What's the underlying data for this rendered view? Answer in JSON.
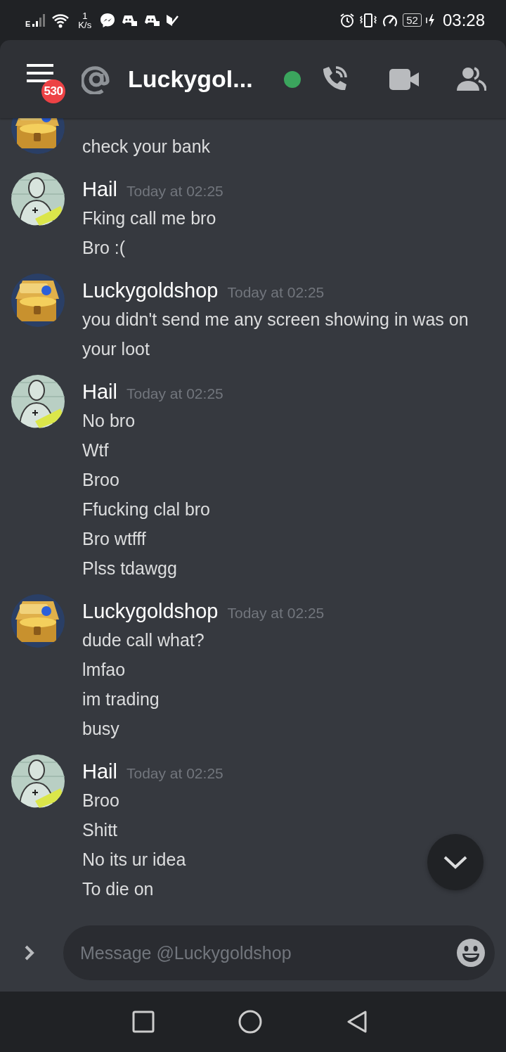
{
  "status_bar": {
    "network": "E",
    "speed_value": "1",
    "speed_unit": "K/s",
    "battery": "52",
    "time": "03:28"
  },
  "header": {
    "badge": "530",
    "title": "Luckygol...",
    "online": true
  },
  "messages": [
    {
      "kind": "continuation",
      "lines": [
        "check your bank"
      ]
    },
    {
      "kind": "group",
      "author": "Hail",
      "time": "Today at 02:25",
      "lines": [
        "Fking call me bro",
        "Bro :("
      ]
    },
    {
      "kind": "group",
      "author": "Luckygoldshop",
      "time": "Today at 02:25",
      "lines": [
        "you didn't send me any screen showing in was on your loot"
      ]
    },
    {
      "kind": "group",
      "author": "Hail",
      "time": "Today at 02:25",
      "lines": [
        "No bro",
        "Wtf",
        "Broo",
        "Ffucking clal bro",
        "Bro wtfff",
        "Plss tdawgg"
      ]
    },
    {
      "kind": "group",
      "author": "Luckygoldshop",
      "time": "Today at 02:25",
      "lines": [
        "dude call what?",
        "lmfao",
        "im trading",
        "busy"
      ]
    },
    {
      "kind": "group",
      "author": "Hail",
      "time": "Today at 02:25",
      "lines": [
        "Broo",
        "Shitt",
        "No its ur idea",
        "To die on"
      ]
    }
  ],
  "composer": {
    "placeholder": "Message @Luckygoldshop"
  }
}
